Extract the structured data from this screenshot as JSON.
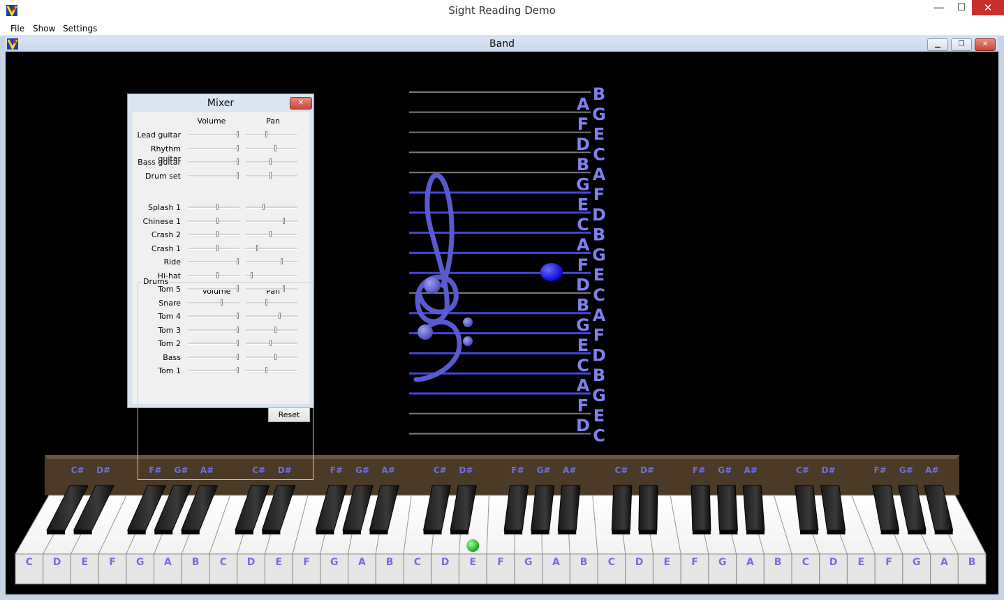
{
  "window": {
    "title": "Sight Reading Demo",
    "minimize_glyph": "—",
    "maximize_glyph": "☐",
    "close_glyph": "✕",
    "icon": "app-icon"
  },
  "menu": {
    "items": [
      "File",
      "Show",
      "Settings"
    ]
  },
  "inner_window": {
    "title": "Band",
    "minimize_glyph": "▁",
    "restore_glyph": "❐",
    "close_glyph": "✕",
    "icon": "app-icon"
  },
  "mixer": {
    "title": "Mixer",
    "close_glyph": "✕",
    "volume_header": "Volume",
    "pan_header": "Pan",
    "instruments": [
      {
        "label": "Lead guitar",
        "volume": 1.0,
        "pan": 0.4
      },
      {
        "label": "Rhythm guitar",
        "volume": 1.0,
        "pan": 0.58
      },
      {
        "label": "Bass guitar",
        "volume": 1.0,
        "pan": 0.49
      },
      {
        "label": "Drum set",
        "volume": 1.0,
        "pan": 0.49
      }
    ],
    "drums_group": "Drums",
    "drums": [
      {
        "label": "Splash 1",
        "volume": 0.58,
        "pan": 0.34
      },
      {
        "label": "Chinese 1",
        "volume": 0.58,
        "pan": 0.76
      },
      {
        "label": "Crash 2",
        "volume": 0.58,
        "pan": 0.49
      },
      {
        "label": "Crash 1",
        "volume": 0.58,
        "pan": 0.21
      },
      {
        "label": "Ride",
        "volume": 1.0,
        "pan": 0.72
      },
      {
        "label": "Hi-hat",
        "volume": 0.58,
        "pan": 0.1
      },
      {
        "label": "Tom 5",
        "volume": 1.0,
        "pan": 0.76
      },
      {
        "label": "Snare",
        "volume": 0.67,
        "pan": 0.4
      },
      {
        "label": "Tom 4",
        "volume": 1.0,
        "pan": 0.67
      },
      {
        "label": "Tom 3",
        "volume": 1.0,
        "pan": 0.58
      },
      {
        "label": "Tom 2",
        "volume": 1.0,
        "pan": 0.49
      },
      {
        "label": "Bass",
        "volume": 1.0,
        "pan": 0.58
      },
      {
        "label": "Tom 1",
        "volume": 1.0,
        "pan": 0.4
      }
    ],
    "reset_label": "Reset"
  },
  "staff": {
    "lines_notes": [
      "A",
      "F",
      "D",
      "B",
      "G",
      "E",
      "C",
      "A",
      "F",
      "D",
      "B",
      "G",
      "E",
      "C",
      "A",
      "F",
      "D"
    ],
    "spaces_notes": [
      "B",
      "G",
      "E",
      "C",
      "A",
      "F",
      "D",
      "B",
      "G",
      "E",
      "C",
      "A",
      "F",
      "D",
      "B",
      "G",
      "E",
      "C"
    ],
    "treble_clef": "treble-clef-icon",
    "bass_clef": "bass-clef-icon",
    "current_note": "E",
    "colors": {
      "label": "#8080f0",
      "active_line": "#4646d8",
      "ledger_line": "#7a7a7a",
      "note": "#1010e0"
    }
  },
  "keyboard": {
    "white_keys": [
      "C",
      "D",
      "E",
      "F",
      "G",
      "A",
      "B",
      "C",
      "D",
      "E",
      "F",
      "G",
      "A",
      "B",
      "C",
      "D",
      "E",
      "F",
      "G",
      "A",
      "B",
      "C",
      "D",
      "E",
      "F",
      "G",
      "A",
      "B",
      "C",
      "D",
      "E",
      "F",
      "G",
      "A",
      "B"
    ],
    "black_key_labels": [
      "C#",
      "D#",
      "F#",
      "G#",
      "A#"
    ],
    "pressed_key": "E",
    "pressed_index": 16,
    "colors": {
      "label": "#7070e0",
      "press_marker": "#22cc22",
      "cabinet": "#4a3a26"
    }
  }
}
